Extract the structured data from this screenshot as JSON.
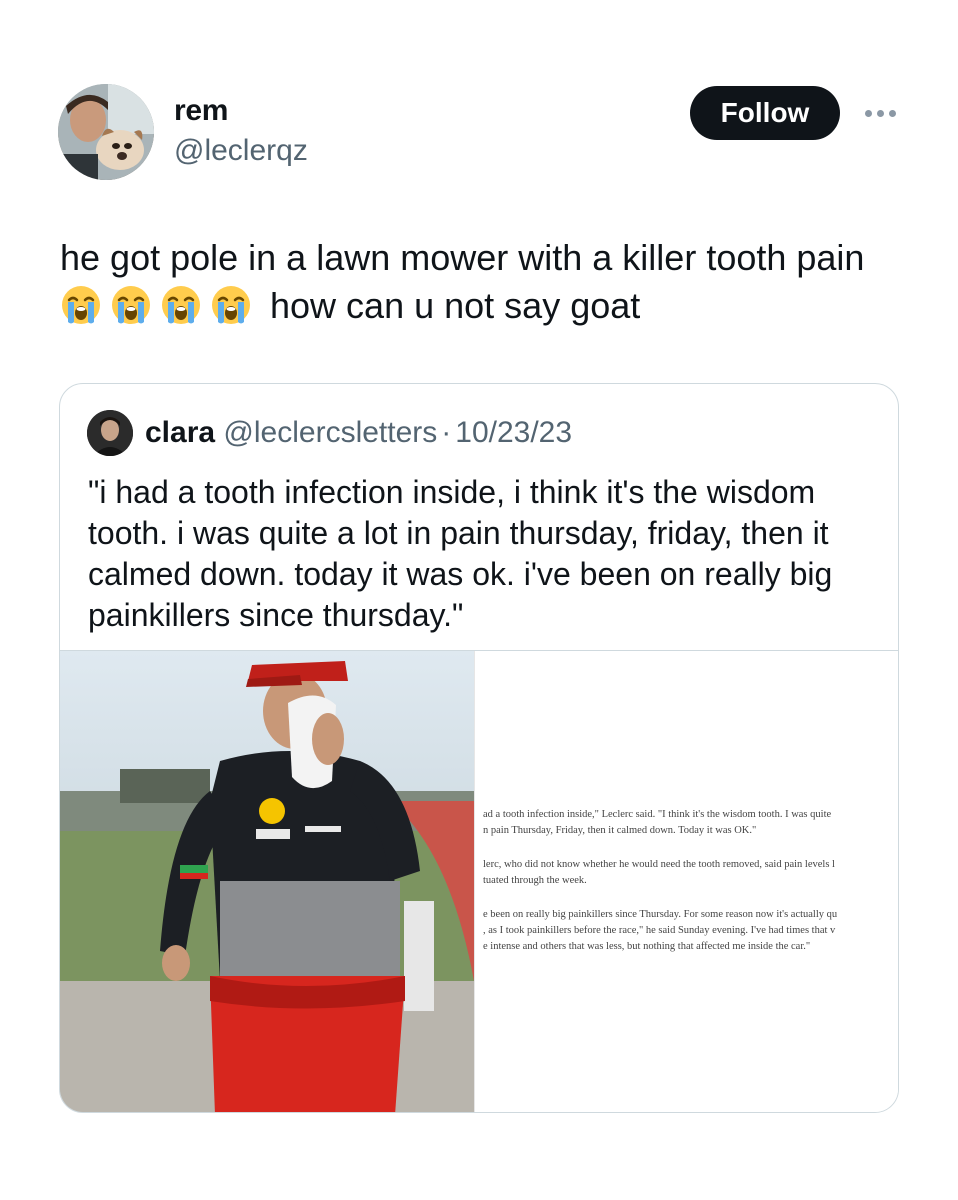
{
  "author": {
    "display_name": "rem",
    "handle": "@leclerqz"
  },
  "follow_label": "Follow",
  "tweet": {
    "text_line1": "he got pole in a lawn mower with a killer tooth pain",
    "text_line2": "how can u not say goat",
    "emoji_count": 4,
    "emoji_name": "loudly-crying-face"
  },
  "quote": {
    "display_name": "clara",
    "handle": "@leclercsletters",
    "separator": "·",
    "date": "10/23/23",
    "text": "\"i had a tooth infection inside, i think it's the wisdom tooth. i was quite a lot in pain thursday, friday, then it calmed down. today it was ok. i've been on really big painkillers since thursday.\"",
    "article_paragraphs": [
      [
        "ad a tooth infection inside,\" Leclerc said. \"I think it's the wisdom tooth. I was quite",
        "n pain Thursday, Friday, then it calmed down. Today it was OK.\""
      ],
      [
        "lerc, who did not know whether he would need the tooth removed, said pain levels l",
        "tuated through the week."
      ],
      [
        "e been on really big painkillers since Thursday. For some reason now it's actually qu",
        ", as I took painkillers before the race,\" he said Sunday evening. I've had times that v",
        "e intense and others that was less, but nothing that affected me inside the car.\""
      ]
    ]
  },
  "colors": {
    "text_primary": "#0f1419",
    "text_secondary": "#536471",
    "border": "#cfd9de",
    "follow_bg": "#0f1419",
    "suit_red": "#d7261e"
  }
}
